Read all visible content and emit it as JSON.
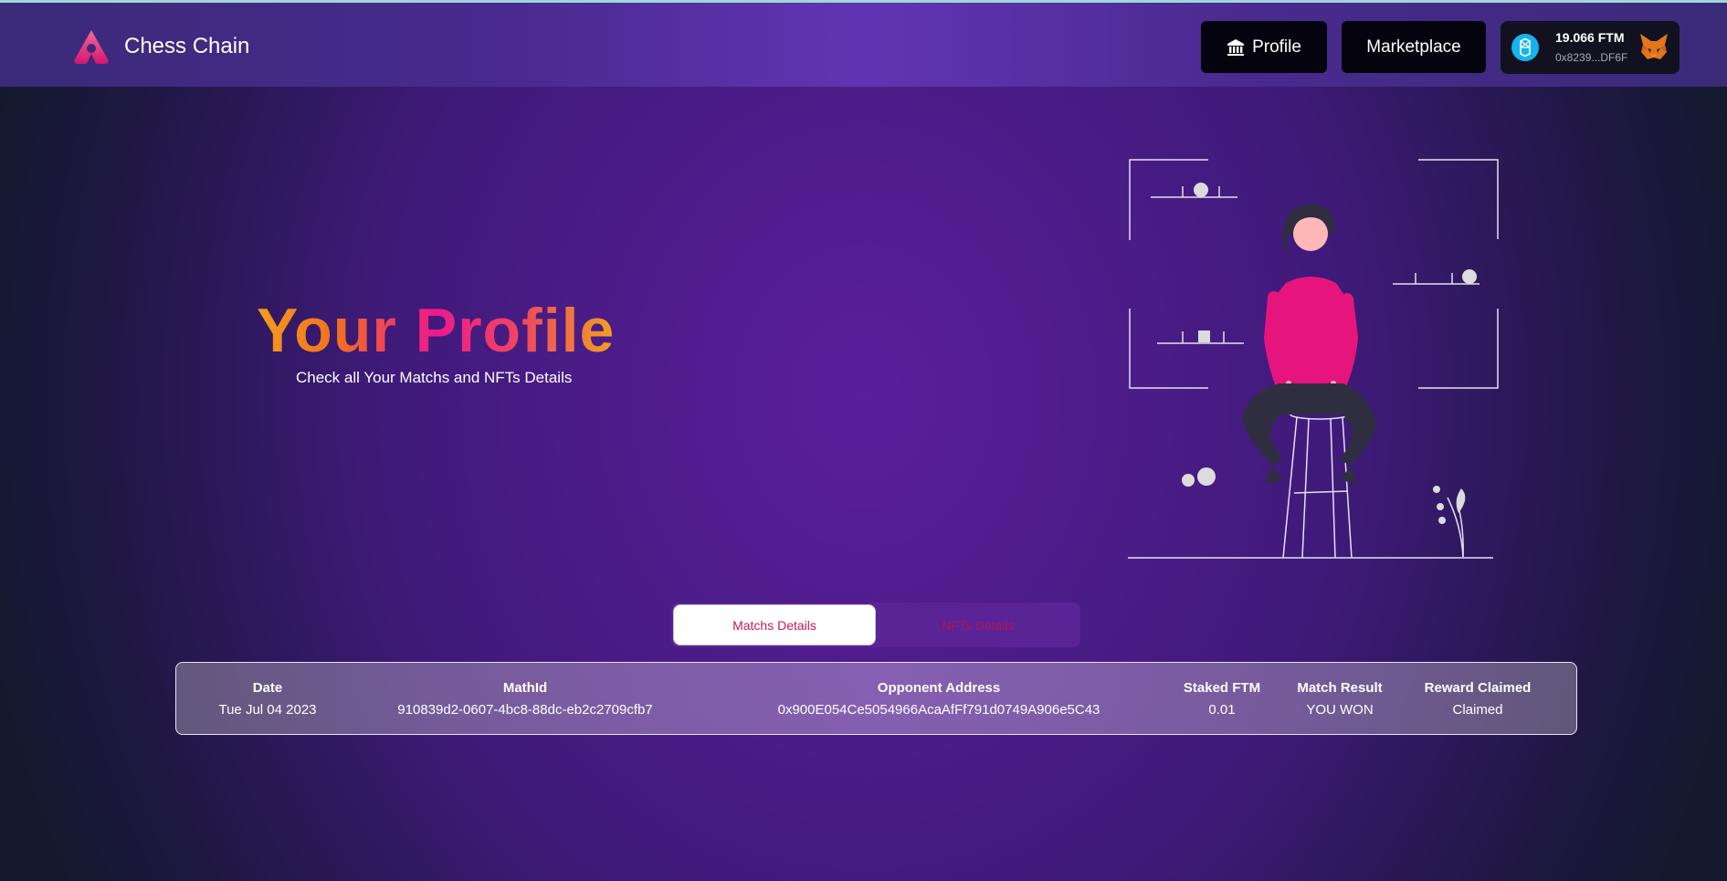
{
  "brand": {
    "name": "Chess Chain"
  },
  "nav": {
    "profile_label": "Profile",
    "marketplace_label": "Marketplace"
  },
  "wallet": {
    "balance": "19.066 FTM",
    "address": "0x8239...DF6F"
  },
  "hero": {
    "title": "Your Profile",
    "subtitle": "Check all Your Matchs and NFTs Details"
  },
  "tabs": [
    {
      "label": "Matchs Details",
      "active": true
    },
    {
      "label": "NFTs Details",
      "active": false
    }
  ],
  "table": {
    "headers": [
      "Date",
      "MathId",
      "Opponent Address",
      "Staked FTM",
      "Match Result",
      "Reward Claimed"
    ],
    "rows": [
      [
        "Tue Jul 04 2023",
        "910839d2-0607-4bc8-88dc-eb2c2709cfb7",
        "0x900E054Ce5054966AcaAfFf791d0749A906e5C43",
        "0.01",
        "YOU WON",
        "Claimed"
      ]
    ]
  },
  "colors": {
    "accent_pink": "#ec1a8c",
    "accent_orange": "#f59c1a",
    "nav_button_bg": "#05040e"
  },
  "icons": [
    "chess-chain-logo-icon",
    "bank-icon",
    "fantom-icon",
    "metamask-fox-icon"
  ]
}
